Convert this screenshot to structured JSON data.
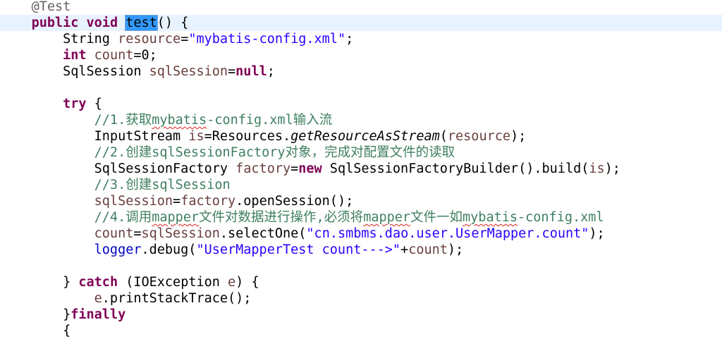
{
  "editor": {
    "lines": {
      "l0": {
        "annotation": "@Test"
      },
      "l1": {
        "kw_public": "public",
        "kw_void": "void",
        "method_name": "test",
        "punct": "() {"
      },
      "l2": {
        "type": "String",
        "var": "resource",
        "eq": "=",
        "value": "\"mybatis-config.xml\"",
        "end": ";"
      },
      "l3": {
        "kw": "int",
        "var": "count",
        "rest": "=0;"
      },
      "l4": {
        "type": "SqlSession",
        "var": "sqlSession",
        "eq": "=",
        "kw_null": "null",
        "end": ";"
      },
      "l6": {
        "kw_try": "try",
        "rest": " {"
      },
      "l7": {
        "c1": "//1.获取",
        "c2": "mybatis",
        "c3": "-config.xml输入流"
      },
      "l8": {
        "t1": "InputStream ",
        "var": "is",
        "t2": "=Resources.",
        "method": "getResourceAsStream",
        "t3": "(",
        "arg": "resource",
        "t4": ");"
      },
      "l9": {
        "c1": "//2.创建",
        "c2": "sqlSessionFactory",
        "c3": "对象，完成对配置文件的读取"
      },
      "l10": {
        "t1": "SqlSessionFactory ",
        "var": "factory",
        "t2": "=",
        "kw_new": "new",
        "t3": " SqlSessionFactoryBuilder().build(",
        "arg": "is",
        "t4": ");"
      },
      "l11": {
        "c1": "//3.创建",
        "c2": "sqlSession"
      },
      "l12": {
        "var1": "sqlSession",
        "t1": "=",
        "var2": "factory",
        "t2": ".openSession();"
      },
      "l13": {
        "c1": "//4.调用",
        "c2": "mapper",
        "c3": "文件对数据进行操作,必须将",
        "c4": "mapper",
        "c5": "文件一如",
        "c6": "mybatis",
        "c7": "-config.xml"
      },
      "l14": {
        "var1": "count",
        "t1": "=",
        "var2": "sqlSession",
        "t2": ".selectOne(",
        "str": "\"cn.smbms.dao.user.UserMapper.count\"",
        "t3": ");"
      },
      "l15": {
        "fld": "logger",
        "t1": ".debug(",
        "str": "\"UserMapperTest count--->\"",
        "t2": "+",
        "var": "count",
        "t3": ");"
      },
      "l17": {
        "t1": "} ",
        "kw_catch": "catch",
        "t2": " (IOException ",
        "var": "e",
        "t3": ") {"
      },
      "l18": {
        "var": "e",
        "t1": ".printStackTrace();"
      },
      "l19": {
        "t1": "}",
        "kw_finally": "finally"
      },
      "l20": {
        "t1": "{"
      }
    }
  },
  "colors": {
    "keyword": "#7f0055",
    "string": "#2a00ff",
    "comment": "#3f7f5f",
    "annotation": "#646464",
    "local_variable": "#6a3e3e",
    "field": "#0000c0",
    "selection": "#3399ff",
    "current_line": "#e8f2fe"
  }
}
